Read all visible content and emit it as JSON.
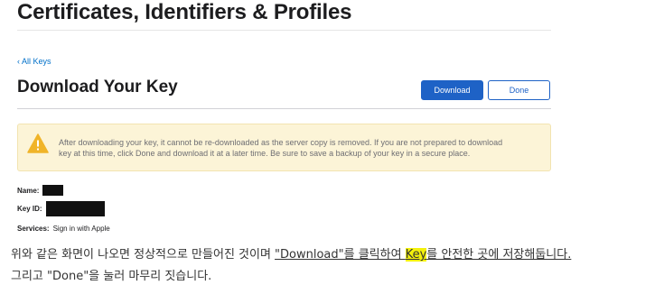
{
  "header": {
    "title": "Certificates, Identifiers & Profiles"
  },
  "nav": {
    "back_link": "‹ All Keys"
  },
  "section": {
    "title": "Download Your Key"
  },
  "buttons": {
    "download": "Download",
    "done": "Done"
  },
  "warning": {
    "icon": "warning-triangle-icon",
    "line1": "After downloading your key, it cannot be re-downloaded as the server copy is removed. If you are not prepared to download",
    "line2": "key at this time, click Done and download it at a later time. Be sure to save a backup of your key in a secure place."
  },
  "details": {
    "name_label": "Name:",
    "keyid_label": "Key ID:",
    "services_label": "Services:",
    "services_value": "Sign in with Apple"
  },
  "caption": {
    "line1_part1": "위와 같은 화면이 나오면 정상적으로 만들어진 것이며 ",
    "line1_part2": "\"Download\"를 클릭하여 ",
    "line1_highlight": "Key",
    "line1_part3": "를 안전한 곳에 저장해둡니다.",
    "line2": "그리고 \"Done\"을 눌러 마무리 짓습니다."
  },
  "colors": {
    "accent": "#1e62c6",
    "link": "#0070c9",
    "warning_bg": "#fcf4d7",
    "warning_icon": "#f0b429",
    "highlight": "#f3f10b"
  }
}
